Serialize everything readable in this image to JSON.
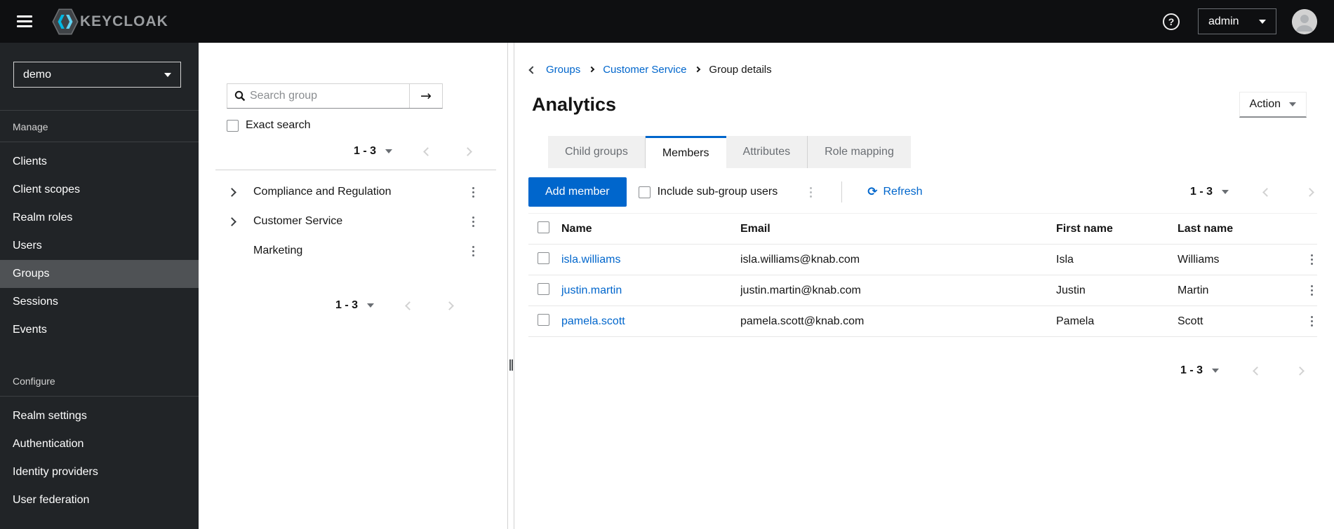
{
  "masthead": {
    "brand": "KEYCLOAK",
    "username": "admin",
    "help_label": "?"
  },
  "sidebar": {
    "realm": "demo",
    "sections": [
      {
        "label": "Manage",
        "items": [
          {
            "label": "Clients"
          },
          {
            "label": "Client scopes"
          },
          {
            "label": "Realm roles"
          },
          {
            "label": "Users"
          },
          {
            "label": "Groups",
            "selected": true
          },
          {
            "label": "Sessions"
          },
          {
            "label": "Events"
          }
        ]
      },
      {
        "label": "Configure",
        "items": [
          {
            "label": "Realm settings"
          },
          {
            "label": "Authentication"
          },
          {
            "label": "Identity providers"
          },
          {
            "label": "User federation"
          }
        ]
      }
    ]
  },
  "tree_panel": {
    "search_placeholder": "Search group",
    "search_button_glyph": "→",
    "exact_search_label": "Exact search",
    "top_pagination_range": "1 - 3",
    "bottom_pagination_range": "1 - 3",
    "groups": [
      {
        "name": "Compliance and Regulation",
        "expandable": true
      },
      {
        "name": "Customer Service",
        "expandable": true
      },
      {
        "name": "Marketing",
        "expandable": false
      }
    ]
  },
  "main": {
    "breadcrumb": [
      {
        "label": "Groups",
        "link": true
      },
      {
        "label": "Customer Service",
        "link": true
      },
      {
        "label": "Group details",
        "link": false
      }
    ],
    "title": "Analytics",
    "action_button_label": "Action",
    "tabs": [
      {
        "label": "Child groups"
      },
      {
        "label": "Members",
        "active": true
      },
      {
        "label": "Attributes"
      },
      {
        "label": "Role mapping"
      }
    ],
    "toolbar": {
      "add_member_label": "Add member",
      "include_subgroups_label": "Include sub-group users",
      "refresh_label": "Refresh",
      "refresh_icon_glyph": "⟳",
      "pagination_range": "1 - 3"
    },
    "table": {
      "headers": [
        "Name",
        "Email",
        "First name",
        "Last name"
      ],
      "rows": [
        {
          "name": "isla.williams",
          "email": "isla.williams@knab.com",
          "first_name": "Isla",
          "last_name": "Williams"
        },
        {
          "name": "justin.martin",
          "email": "justin.martin@knab.com",
          "first_name": "Justin",
          "last_name": "Martin"
        },
        {
          "name": "pamela.scott",
          "email": "pamela.scott@knab.com",
          "first_name": "Pamela",
          "last_name": "Scott"
        }
      ],
      "bottom_pagination_range": "1 - 3"
    }
  },
  "colors": {
    "primary": "#0066cc",
    "link": "#0066cc",
    "masthead_bg": "#0e0f11",
    "sidebar_bg": "#212427",
    "sidebar_selected_bg": "#4f5255",
    "tab_inactive_bg": "#f0f0f0",
    "muted_text": "#6a6e73",
    "border": "#d2d2d2",
    "row_border": "#e7e7e7"
  }
}
